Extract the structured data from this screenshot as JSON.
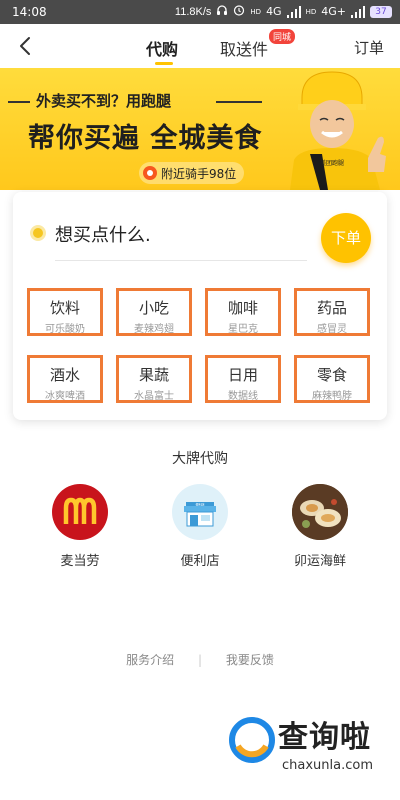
{
  "status_bar": {
    "time": "14:08",
    "net_speed": "11.8K/s",
    "sim1_tag": "HD",
    "net1": "4G",
    "sim2_tag": "HD",
    "net2": "4G+",
    "battery": "37"
  },
  "nav": {
    "tabs": [
      {
        "label": "代购",
        "active": true
      },
      {
        "label": "取送件",
        "badge": "同城"
      }
    ],
    "orders_label": "订单"
  },
  "banner": {
    "tagline": "外卖买不到？用跑腿",
    "headline": "帮你买遍 全城美食",
    "riders_nearby": "附近骑手98位",
    "rider_shirt_text": "美团跑腿"
  },
  "order_card": {
    "prompt": "想买点什么.",
    "order_button": "下单",
    "categories": [
      {
        "name": "饮料",
        "sub": "可乐酸奶"
      },
      {
        "name": "小吃",
        "sub": "麦辣鸡翅"
      },
      {
        "name": "咖啡",
        "sub": "星巴克"
      },
      {
        "name": "药品",
        "sub": "感冒灵"
      },
      {
        "name": "酒水",
        "sub": "冰爽啤酒"
      },
      {
        "name": "果蔬",
        "sub": "水晶富士"
      },
      {
        "name": "日用",
        "sub": "数据线"
      },
      {
        "name": "零食",
        "sub": "麻辣鸭脖"
      }
    ]
  },
  "brands": {
    "title": "大牌代购",
    "items": [
      {
        "label": "麦当劳",
        "icon": "mcdonalds-logo"
      },
      {
        "label": "便利店",
        "icon": "store-icon",
        "icon_text": "便利店"
      },
      {
        "label": "卯运海鲜",
        "icon": "seafood-photo"
      }
    ]
  },
  "footer": {
    "service_intro": "服务介绍",
    "feedback": "我要反馈",
    "separator": "|"
  },
  "watermark": {
    "brand": "查询啦",
    "url": "chaxunla.com"
  },
  "colors": {
    "accent": "#ffc300",
    "highlight_border": "#ef7a35",
    "badge_red": "#f2443b"
  }
}
